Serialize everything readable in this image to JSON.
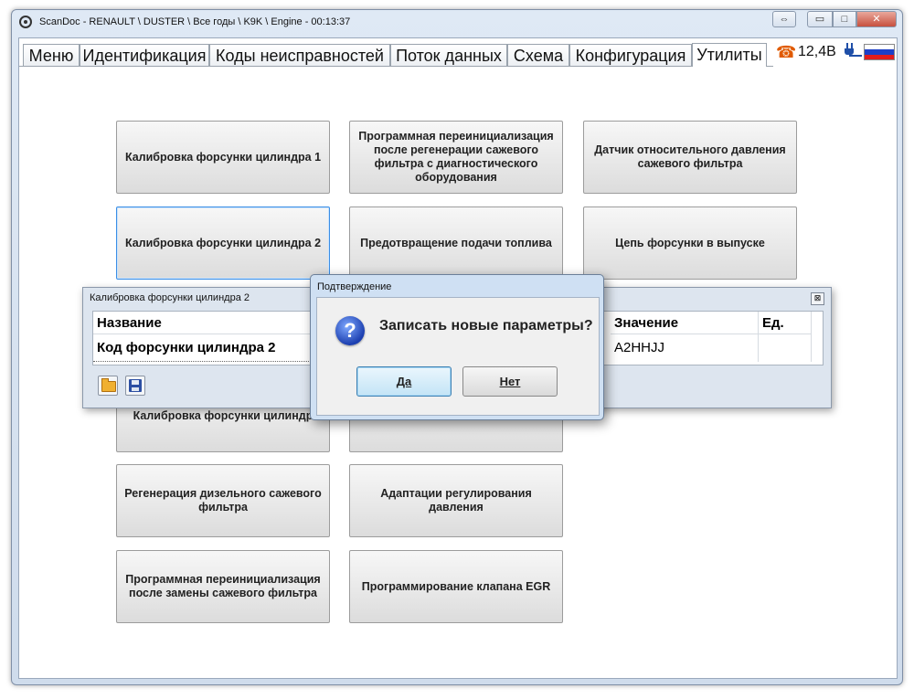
{
  "window": {
    "title": "ScanDoc - RENAULT \\ DUSTER \\ Все годы \\ K9K \\ Engine - 00:13:37",
    "controls": {
      "resize": "⇔",
      "minimize": "▭",
      "maximize": "□",
      "close": "✕"
    }
  },
  "tabs": [
    "Меню",
    "Идентификация",
    "Коды неисправностей",
    "Поток данных",
    "Схема",
    "Конфигурация",
    "Утилиты"
  ],
  "active_tab": "Утилиты",
  "status": {
    "voltage": "12,4В",
    "phone_icon": "phone-icon",
    "plug_icon": "plug-icon",
    "flag_colors": [
      "#ffffff",
      "#1c3fc8",
      "#e21c1c"
    ]
  },
  "utilities": [
    "Калибровка форсунки цилиндра 1",
    "Программная переинициализация после регенерации сажевого фильтра с диагностического оборудования",
    "Датчик относительного давления сажевого фильтра",
    "Калибровка форсунки цилиндра 2",
    "Предотвращение подачи топлива",
    "Цепь форсунки в выпуске",
    "Калибровка форсунки цилиндр",
    "Регенерация дизельного сажевого фильтра",
    "Адаптации регулирования давления",
    "Программная переинициализация после замены сажевого фильтра",
    "Программирование клапана EGR"
  ],
  "injector_dialog": {
    "title": "Калибровка форсунки цилиндра 2",
    "close": "⊠",
    "columns": {
      "name": "Название",
      "value": "Значение",
      "unit": "Ед."
    },
    "row": {
      "name": "Код форсунки цилиндра 2",
      "value": "A2HHJJ",
      "unit": ""
    }
  },
  "confirm": {
    "title": "Подтверждение",
    "icon_glyph": "?",
    "message": "Записать новые параметры?",
    "yes_label": "Да",
    "no_label": "Нет"
  }
}
